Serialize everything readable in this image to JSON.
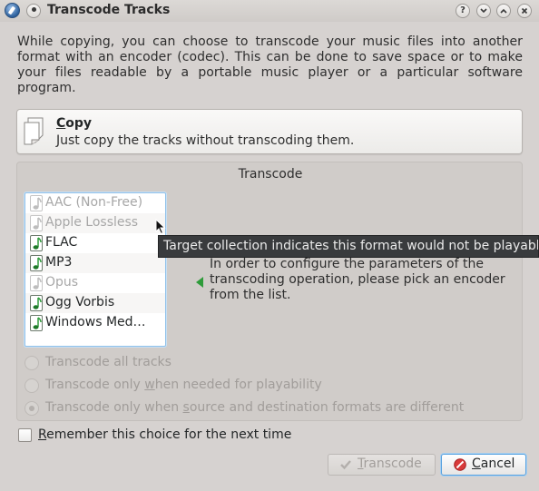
{
  "window": {
    "title": "Transcode Tracks",
    "buttons": {
      "help": "?",
      "minimize": "⌄",
      "maximize": "⌃",
      "close": "✕"
    }
  },
  "description": "While copying, you can choose to transcode your music files into another format with an encoder (codec). This can be done to save space or to make your files readable by a portable music player or a particular software program.",
  "copy_option": {
    "title_mnemonic": "C",
    "title_rest": "opy",
    "subtitle": "Just copy the tracks without transcoding them."
  },
  "transcode_group": {
    "title": "Transcode",
    "encoders": [
      {
        "label": "AAC (Non-Free)",
        "enabled": false
      },
      {
        "label": "Apple Lossless",
        "enabled": false
      },
      {
        "label": "FLAC",
        "enabled": true
      },
      {
        "label": "MP3",
        "enabled": true
      },
      {
        "label": "Opus",
        "enabled": false
      },
      {
        "label": "Ogg Vorbis",
        "enabled": true
      },
      {
        "label": "Windows Med…",
        "enabled": true
      }
    ],
    "hint": "In order to configure the parameters of the transcoding operation, please pick an encoder from the list.",
    "radios": [
      {
        "before": "Transcode all tracks",
        "mnemonic": "",
        "after": "",
        "checked": false
      },
      {
        "before": "Transcode only ",
        "mnemonic": "w",
        "after": "hen needed for playability",
        "checked": false
      },
      {
        "before": "Transcode only when ",
        "mnemonic": "s",
        "after": "ource and destination formats are different",
        "checked": true
      }
    ]
  },
  "remember": {
    "mnemonic": "R",
    "rest": "emember this choice for the next time",
    "checked": false
  },
  "buttons": {
    "transcode": {
      "mnemonic": "T",
      "rest": "ranscode",
      "enabled": false
    },
    "cancel": {
      "mnemonic": "C",
      "rest": "ancel",
      "enabled": true
    }
  },
  "tooltip": "Target collection indicates this format would not be playable",
  "colors": {
    "accent": "#3daee9",
    "note_green": "#2e9b3a",
    "tooltip_bg": "#393b3d"
  }
}
